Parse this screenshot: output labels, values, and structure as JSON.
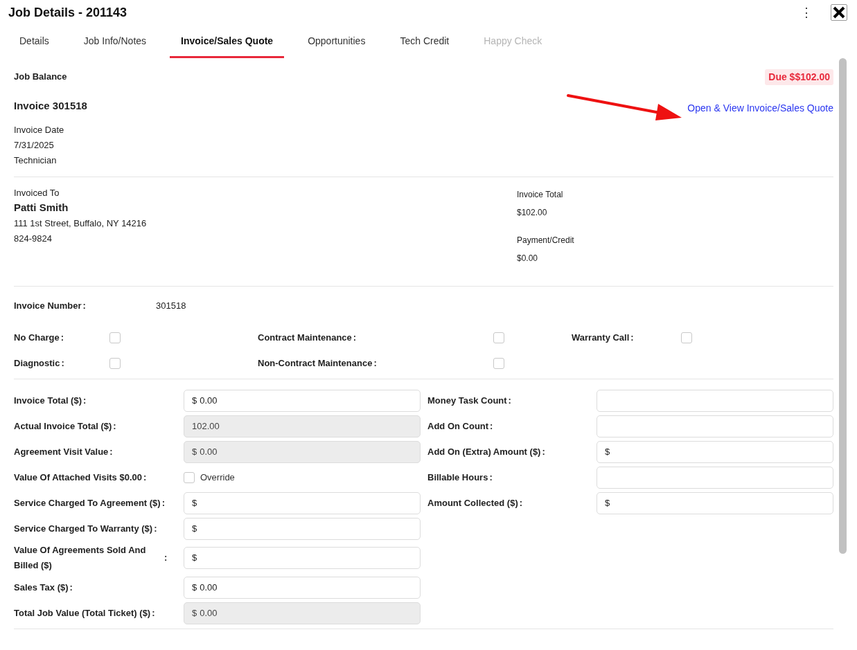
{
  "window": {
    "title": "Job Details - 201143",
    "menu_icon": "⋮"
  },
  "tabs": [
    {
      "label": "Details",
      "selected": false,
      "disabled": false
    },
    {
      "label": "Job Info/Notes",
      "selected": false,
      "disabled": false
    },
    {
      "label": "Invoice/Sales Quote",
      "selected": true,
      "disabled": false
    },
    {
      "label": "Opportunities",
      "selected": false,
      "disabled": false
    },
    {
      "label": "Tech Credit",
      "selected": false,
      "disabled": false
    },
    {
      "label": "Happy Check",
      "selected": false,
      "disabled": true
    }
  ],
  "job_balance": {
    "label": "Job Balance",
    "due": "Due $$102.00"
  },
  "invoice": {
    "title": "Invoice 301518",
    "link": "Open & View Invoice/Sales Quote",
    "lines": [
      "Invoice Date",
      "7/31/2025",
      "Technician"
    ]
  },
  "invoiced_to": {
    "label": "Invoiced To",
    "name": "Patti Smith",
    "address": "111 1st Street, Buffalo, NY 14216",
    "phone": "824-9824"
  },
  "totals": [
    {
      "label": "Invoice Total",
      "value": "$102.00"
    },
    {
      "label": "Payment/Credit",
      "value": "$0.00"
    }
  ],
  "invoice_number": {
    "label": "Invoice Number",
    "separator": ":",
    "value": "301518"
  },
  "flags": [
    [
      {
        "label": "No Charge",
        "separator": ":",
        "checked": false
      },
      {
        "label": "Contract Maintenance",
        "separator": ":",
        "checked": false
      },
      {
        "label": "Warranty Call",
        "separator": ":",
        "checked": false
      }
    ],
    [
      {
        "label": "Diagnostic",
        "separator": ":",
        "checked": false
      },
      {
        "label": "Non-Contract Maintenance",
        "separator": ":",
        "checked": false
      }
    ]
  ],
  "left_fields": [
    {
      "kind": "input",
      "label": "Invoice Total ($)",
      "separator": ":",
      "prefix": "$",
      "value": "0.00",
      "disabled": false
    },
    {
      "kind": "input",
      "label": "Actual Invoice Total ($)",
      "separator": ":",
      "value": "102.00",
      "disabled": true
    },
    {
      "kind": "input",
      "label": "Agreement Visit Value",
      "separator": ":",
      "prefix": "$",
      "value": "0.00",
      "disabled": true
    },
    {
      "kind": "checkbox",
      "label": "Value Of Attached Visits $0.00",
      "separator": ":",
      "option": "Override",
      "checked": false
    },
    {
      "kind": "input",
      "label": "Service Charged To Agreement ($)",
      "separator": ":",
      "prefix": "$",
      "disabled": false
    },
    {
      "kind": "input",
      "label": "Service Charged To Warranty ($)",
      "separator": ":",
      "prefix": "$",
      "disabled": false
    },
    {
      "kind": "input",
      "label": "Value Of Agreements Sold And Billed ($)",
      "separator": ":",
      "prefix": "$",
      "disabled": false
    },
    {
      "kind": "input",
      "label": "Sales Tax ($)",
      "separator": ":",
      "prefix": "$",
      "value": "0.00",
      "disabled": false
    },
    {
      "kind": "input",
      "label": "Total Job Value (Total Ticket) ($)",
      "separator": ":",
      "prefix": "$",
      "value": "0.00",
      "disabled": true
    }
  ],
  "right_fields": [
    {
      "kind": "input",
      "label": "Money Task Count",
      "separator": ":",
      "disabled": false
    },
    {
      "kind": "input",
      "label": "Add On Count",
      "separator": ":",
      "disabled": false
    },
    {
      "kind": "input",
      "label": "Add On (Extra) Amount ($)",
      "separator": ":",
      "prefix": "$",
      "disabled": false
    },
    {
      "kind": "input",
      "label": "Billable Hours",
      "separator": ":",
      "disabled": false
    },
    {
      "kind": "input",
      "label": "Amount Collected ($)",
      "separator": ":",
      "prefix": "$",
      "disabled": false
    }
  ]
}
